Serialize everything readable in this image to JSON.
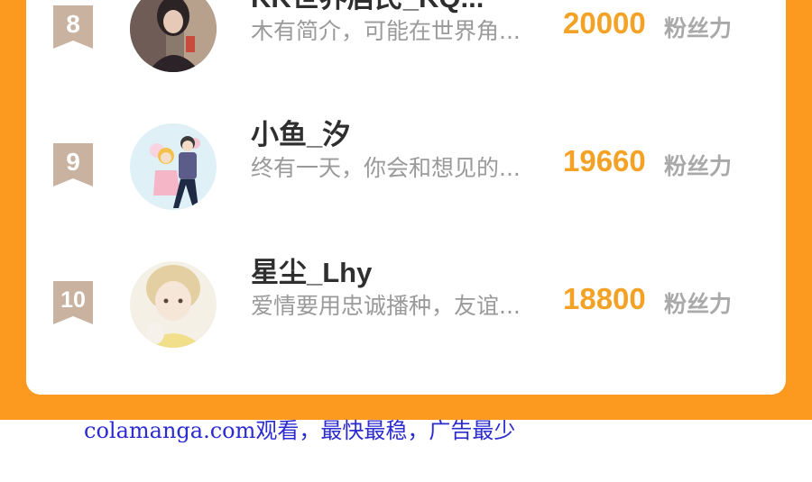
{
  "rows": [
    {
      "rank": "8",
      "name": "KK世界居民_KQ...",
      "desc": "木有简介，可能在世界角...",
      "fans": "20000",
      "fans_label": "粉丝力",
      "avatar": "avatar-girl-photo"
    },
    {
      "rank": "9",
      "name": "小鱼_汐",
      "desc": "终有一天，你会和想见的...",
      "fans": "19660",
      "fans_label": "粉丝力",
      "avatar": "avatar-couple-illustration"
    },
    {
      "rank": "10",
      "name": "星尘_Lhy",
      "desc": "爱情要用忠诚播种，友谊...",
      "fans": "18800",
      "fans_label": "粉丝力",
      "avatar": "avatar-boy-illustration"
    }
  ],
  "footer": {
    "text": "colamanga.com观看，最快最稳，广告最少"
  },
  "colors": {
    "accent": "#fb9a1f",
    "fans": "#f3a225",
    "rank_badge": "#c9b3a0"
  }
}
